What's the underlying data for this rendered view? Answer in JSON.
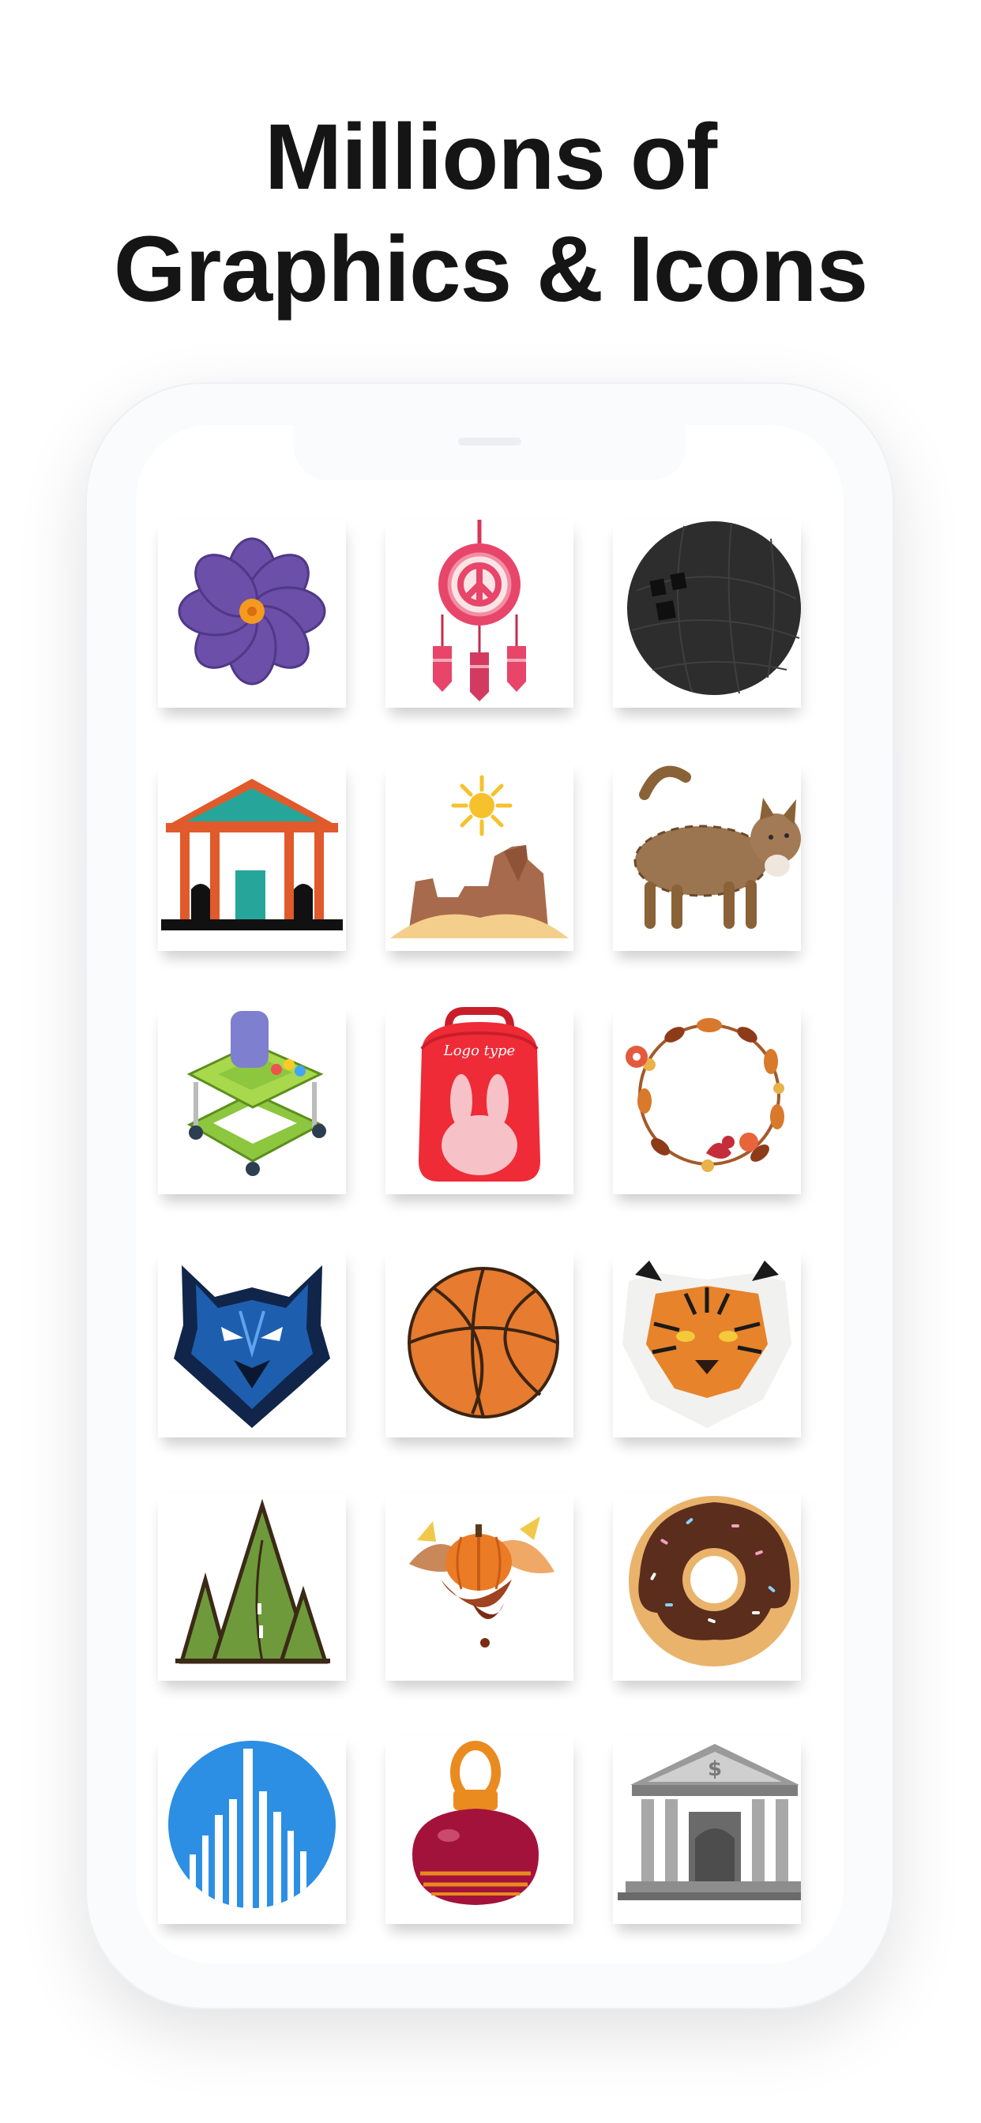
{
  "headline": {
    "line1": "Millions of",
    "line2": "Graphics & Icons"
  },
  "grid": {
    "tiles": [
      {
        "name": "purple-flower-icon"
      },
      {
        "name": "dreamcatcher-peace-icon"
      },
      {
        "name": "bowling-ball-icon"
      },
      {
        "name": "pavilion-building-icon"
      },
      {
        "name": "desert-canyon-sun-icon"
      },
      {
        "name": "cat-icon"
      },
      {
        "name": "baby-walker-icon"
      },
      {
        "name": "bunny-backpack-icon",
        "text": "Logo type"
      },
      {
        "name": "autumn-wreath-icon"
      },
      {
        "name": "wolf-mascot-icon"
      },
      {
        "name": "basketball-icon"
      },
      {
        "name": "tiger-face-icon"
      },
      {
        "name": "mountain-road-icon"
      },
      {
        "name": "autumn-pumpkin-bouquet-icon"
      },
      {
        "name": "donut-icon"
      },
      {
        "name": "city-skyline-circle-icon"
      },
      {
        "name": "ornament-bauble-icon"
      },
      {
        "name": "bank-building-icon",
        "text": "$"
      }
    ]
  }
}
